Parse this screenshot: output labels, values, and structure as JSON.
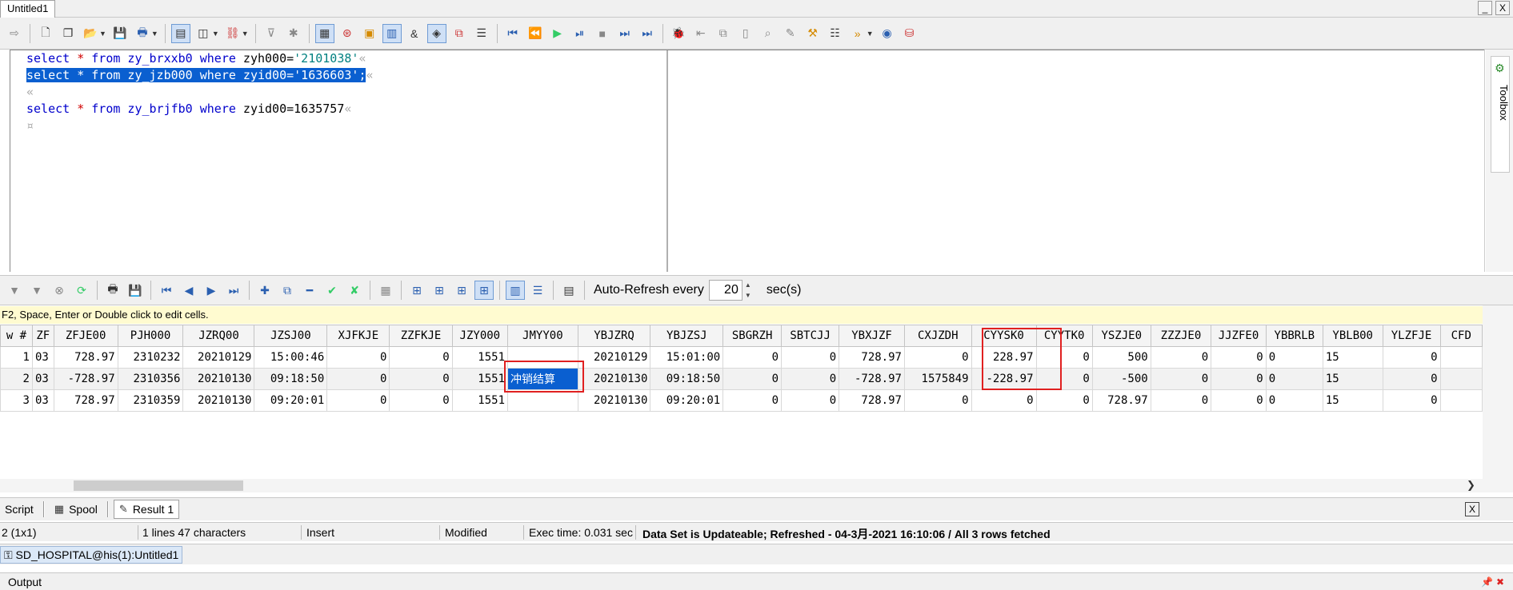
{
  "window": {
    "tab_title": "Untitled1",
    "min_label": "_",
    "close_label": "X"
  },
  "editor": {
    "line1": {
      "pre": "select ",
      "star": "*",
      "mid": " from zy_brxxb0 ",
      "kw": "where",
      "cond": " zyh000=",
      "str": "'2101038'",
      "pil": "«"
    },
    "line2": {
      "pre": "select ",
      "star": "*",
      "mid": " from zy_jzb000 ",
      "kw": "where",
      "cond": " zyid00=",
      "str": "'1636603'",
      "end": ";",
      "pil": "«"
    },
    "line3": {
      "pil": "«"
    },
    "line4": {
      "pre": "select ",
      "star": "*",
      "mid": " from zy_brjfb0 ",
      "kw": "where",
      "cond": " zyid00=1635757",
      "pil": "«"
    },
    "line5": {
      "pil": "¤"
    }
  },
  "toolbox": {
    "label": "Toolbox"
  },
  "grid_toolbar": {
    "auto_refresh_label": "Auto-Refresh every",
    "auto_refresh_value": "20",
    "unit_label": "sec(s)"
  },
  "hint": "F2, Space, Enter or Double click to edit cells.",
  "result": {
    "columns": [
      "w #",
      "ZF",
      "ZFJE00",
      "PJH000",
      "JZRQ00",
      "JZSJ00",
      "XJFKJE",
      "ZZFKJE",
      "JZY000",
      "JMYY00",
      "YBJZRQ",
      "YBJZSJ",
      "SBGRZH",
      "SBTCJJ",
      "YBXJZF",
      "CXJZDH",
      "CYYSK0",
      "CYYTK0",
      "YSZJE0",
      "ZZZJE0",
      "JJZFE0",
      "YBBRLB",
      "YBLB00",
      "YLZFJE",
      "CFD"
    ],
    "rows": [
      [
        "1",
        "03",
        "728.97",
        "2310232",
        "20210129",
        "15:00:46",
        "0",
        "0",
        "1551",
        "",
        "20210129",
        "15:01:00",
        "0",
        "0",
        "728.97",
        "0",
        "228.97",
        "0",
        "500",
        "0",
        "0",
        "0",
        "15",
        "0",
        ""
      ],
      [
        "2",
        "03",
        "-728.97",
        "2310356",
        "20210130",
        "09:18:50",
        "0",
        "0",
        "1551",
        "冲销结算",
        "20210130",
        "09:18:50",
        "0",
        "0",
        "-728.97",
        "1575849",
        "-228.97",
        "0",
        "-500",
        "0",
        "0",
        "0",
        "15",
        "0",
        ""
      ],
      [
        "3",
        "03",
        "728.97",
        "2310359",
        "20210130",
        "09:20:01",
        "0",
        "0",
        "1551",
        "",
        "20210130",
        "09:20:01",
        "0",
        "0",
        "728.97",
        "0",
        "0",
        "0",
        "728.97",
        "0",
        "0",
        "0",
        "15",
        "0",
        ""
      ]
    ]
  },
  "bottom_tabs": [
    "Script",
    "Spool",
    "Result 1"
  ],
  "status": {
    "position": "2 (1x1)",
    "lines": "1 lines 47 characters",
    "mode": "Insert",
    "modified": "Modified",
    "exec_time": "Exec time: 0.031 sec",
    "message": "Data Set is Updateable; Refreshed - 04-3月-2021 16:10:06 / All 3 rows fetched"
  },
  "session": "SD_HOSPITAL@his(1):Untitled1",
  "output": {
    "label": "Output"
  }
}
